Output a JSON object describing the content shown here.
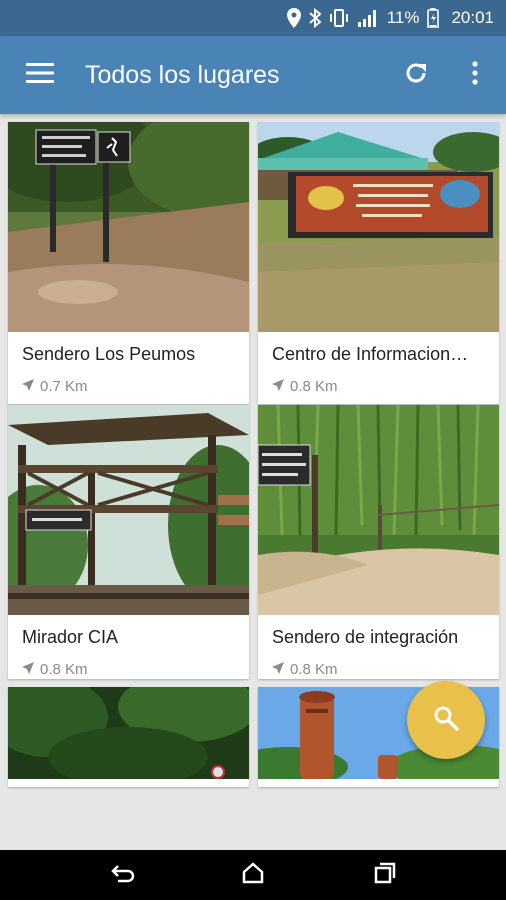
{
  "status_bar": {
    "battery_percent": "11%",
    "time": "20:01",
    "icons": [
      "location-icon",
      "bluetooth-icon",
      "vibrate-icon",
      "signal-icon",
      "battery-icon"
    ]
  },
  "app_bar": {
    "title": "Todos los lugares",
    "icons": [
      "menu-icon",
      "refresh-icon",
      "more-vert-icon"
    ]
  },
  "places": [
    {
      "name": "Sendero Los Peumos",
      "distance": "0.7 Km"
    },
    {
      "name": "Centro de Informacion…",
      "distance": "0.8 Km"
    },
    {
      "name": "Mirador CIA",
      "distance": "0.8 Km"
    },
    {
      "name": "Sendero de integración",
      "distance": "0.8 Km"
    }
  ],
  "fab": {
    "icon": "search-icon",
    "color": "#e9c14a"
  },
  "colors": {
    "status_bar": "#3a6891",
    "app_bar": "#4a84b6",
    "background": "#e6e6e6"
  },
  "nav_bar": {
    "icons": [
      "back-icon",
      "home-icon",
      "recents-icon"
    ]
  }
}
